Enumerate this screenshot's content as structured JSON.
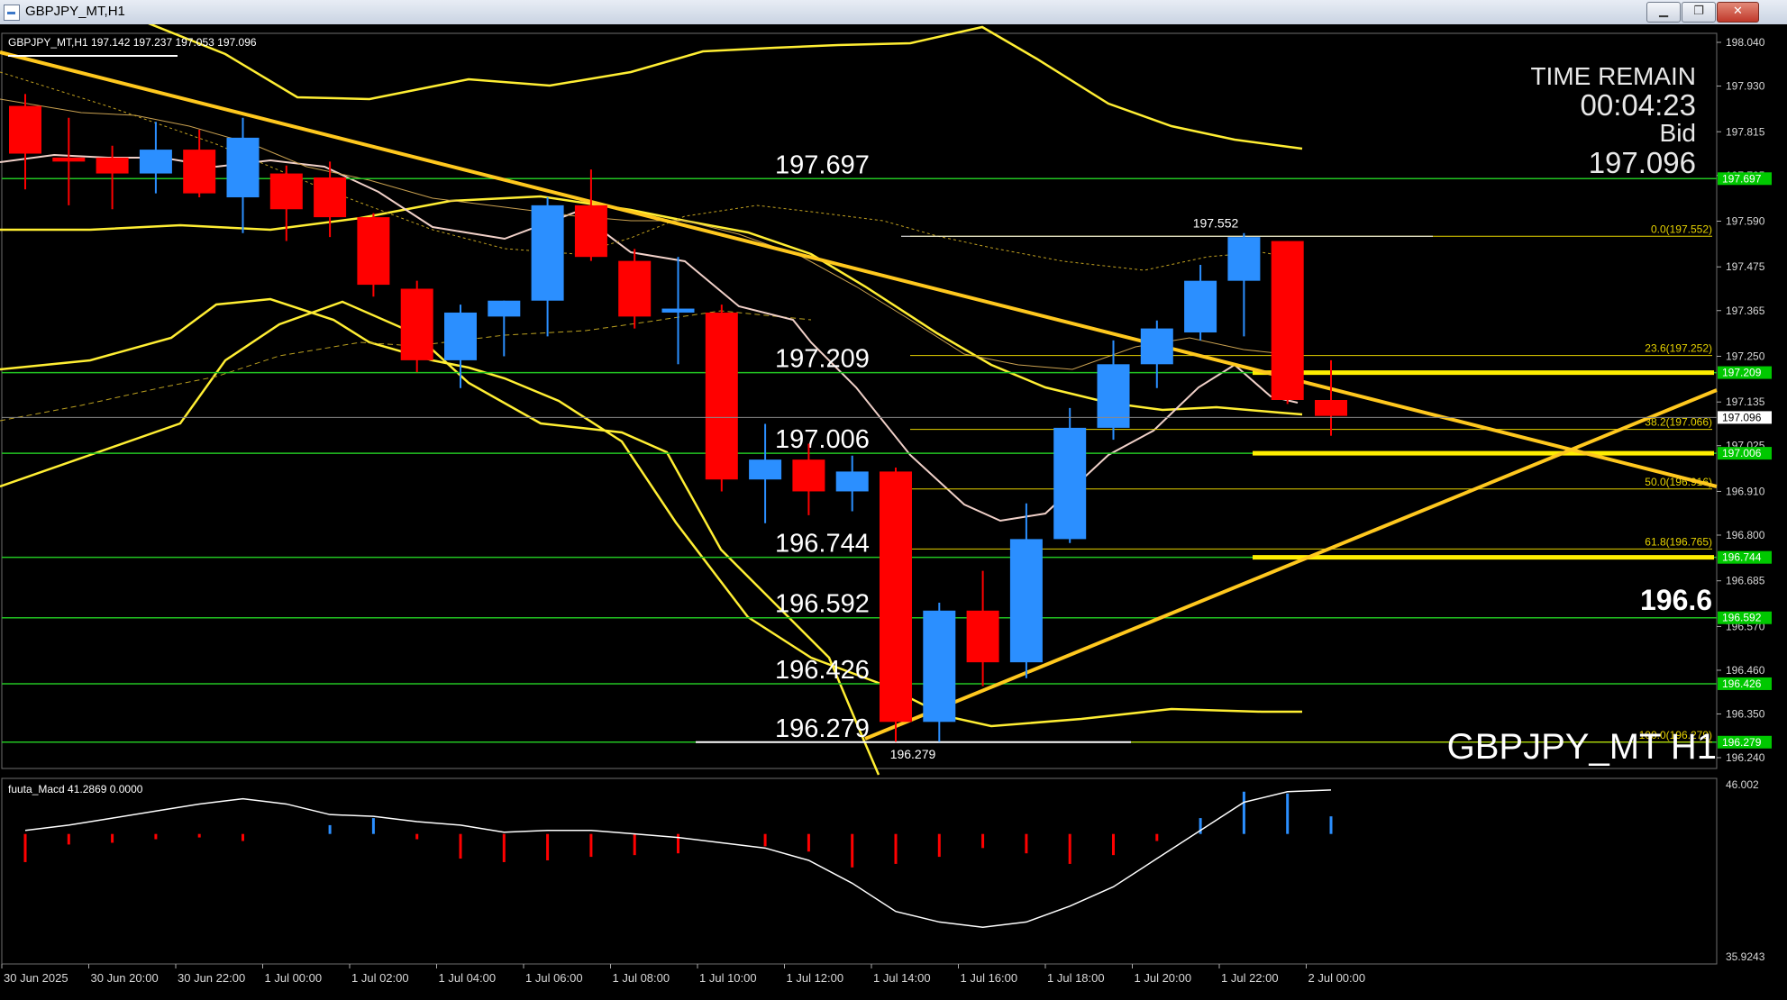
{
  "window": {
    "title": "GBPJPY_MT,H1",
    "controls": {
      "minimize": "▁",
      "maximize": "❐",
      "close": "✕"
    }
  },
  "chart_header": {
    "caption": "GBPJPY_MT,H1  197.142 197.237 197.053 197.096"
  },
  "timer": {
    "time_remain_label": "TIME REMAIN",
    "time_remain_value": "00:04:23",
    "bid_label": "Bid",
    "bid_value": "197.096"
  },
  "big_price_text": "196.6",
  "symbol_label": "GBPJPY_MT H1",
  "macd_caption": "fuuta_Macd 41.2869  0.0000",
  "colors": {
    "background": "#000000",
    "bull_candle": "#2b8fff",
    "bear_candle": "#ff0000",
    "bollinger": "#ffee33",
    "trendline": "#ffc81e",
    "level_line": "#22c422",
    "fibo": "#e6d200",
    "price_label_bg": "#00c800",
    "ma_line": "#f0d0c8"
  },
  "chart_data": {
    "type": "candlestick",
    "symbol": "GBPJPY_MT",
    "timeframe": "H1",
    "ylim": [
      196.24,
      198.04
    ],
    "y_ticks": [
      "198.040",
      "197.930",
      "197.815",
      "197.705",
      "197.590",
      "197.475",
      "197.365",
      "197.250",
      "197.135",
      "197.025",
      "196.910",
      "196.800",
      "196.685",
      "196.570",
      "196.460",
      "196.350",
      "196.240"
    ],
    "x_ticks": [
      "30 Jun 2025",
      "30 Jun 20:00",
      "30 Jun 22:00",
      "1 Jul 00:00",
      "1 Jul 02:00",
      "1 Jul 04:00",
      "1 Jul 06:00",
      "1 Jul 08:00",
      "1 Jul 10:00",
      "1 Jul 12:00",
      "1 Jul 14:00",
      "1 Jul 16:00",
      "1 Jul 18:00",
      "1 Jul 20:00",
      "1 Jul 22:00",
      "2 Jul 00:00"
    ],
    "candles": [
      {
        "o": 197.88,
        "h": 197.91,
        "l": 197.67,
        "c": 197.76
      },
      {
        "o": 197.75,
        "h": 197.85,
        "l": 197.63,
        "c": 197.74
      },
      {
        "o": 197.75,
        "h": 197.78,
        "l": 197.62,
        "c": 197.71
      },
      {
        "o": 197.71,
        "h": 197.84,
        "l": 197.66,
        "c": 197.77
      },
      {
        "o": 197.77,
        "h": 197.82,
        "l": 197.65,
        "c": 197.66
      },
      {
        "o": 197.65,
        "h": 197.85,
        "l": 197.56,
        "c": 197.8
      },
      {
        "o": 197.71,
        "h": 197.73,
        "l": 197.54,
        "c": 197.62
      },
      {
        "o": 197.7,
        "h": 197.74,
        "l": 197.55,
        "c": 197.6
      },
      {
        "o": 197.6,
        "h": 197.61,
        "l": 197.4,
        "c": 197.43
      },
      {
        "o": 197.42,
        "h": 197.44,
        "l": 197.21,
        "c": 197.24
      },
      {
        "o": 197.24,
        "h": 197.38,
        "l": 197.17,
        "c": 197.36
      },
      {
        "o": 197.35,
        "h": 197.39,
        "l": 197.25,
        "c": 197.39
      },
      {
        "o": 197.39,
        "h": 197.65,
        "l": 197.3,
        "c": 197.63
      },
      {
        "o": 197.63,
        "h": 197.72,
        "l": 197.49,
        "c": 197.5
      },
      {
        "o": 197.49,
        "h": 197.52,
        "l": 197.32,
        "c": 197.35
      },
      {
        "o": 197.36,
        "h": 197.5,
        "l": 197.23,
        "c": 197.37
      },
      {
        "o": 197.36,
        "h": 197.38,
        "l": 196.91,
        "c": 196.94
      },
      {
        "o": 196.94,
        "h": 197.08,
        "l": 196.83,
        "c": 196.99
      },
      {
        "o": 196.99,
        "h": 197.03,
        "l": 196.85,
        "c": 196.91
      },
      {
        "o": 196.91,
        "h": 197.0,
        "l": 196.86,
        "c": 196.96
      },
      {
        "o": 196.96,
        "h": 196.97,
        "l": 196.28,
        "c": 196.33
      },
      {
        "o": 196.33,
        "h": 196.63,
        "l": 196.28,
        "c": 196.61
      },
      {
        "o": 196.61,
        "h": 196.71,
        "l": 196.42,
        "c": 196.48
      },
      {
        "o": 196.48,
        "h": 196.88,
        "l": 196.44,
        "c": 196.79
      },
      {
        "o": 196.79,
        "h": 197.12,
        "l": 196.78,
        "c": 197.07
      },
      {
        "o": 197.07,
        "h": 197.29,
        "l": 197.04,
        "c": 197.23
      },
      {
        "o": 197.23,
        "h": 197.34,
        "l": 197.17,
        "c": 197.32
      },
      {
        "o": 197.31,
        "h": 197.48,
        "l": 197.29,
        "c": 197.44
      },
      {
        "o": 197.44,
        "h": 197.56,
        "l": 197.3,
        "c": 197.55
      },
      {
        "o": 197.54,
        "h": 197.54,
        "l": 197.13,
        "c": 197.14
      },
      {
        "o": 197.14,
        "h": 197.24,
        "l": 197.05,
        "c": 197.1
      }
    ],
    "levels": [
      {
        "price": 197.697,
        "label": "197.697",
        "tag": "197.697"
      },
      {
        "price": 197.209,
        "label": "197.209",
        "tag": "197.209"
      },
      {
        "price": 197.006,
        "label": "197.006",
        "tag": "197.006"
      },
      {
        "price": 196.744,
        "label": "196.744",
        "tag": "196.744"
      },
      {
        "price": 196.592,
        "label": "196.592",
        "tag": "196.592"
      },
      {
        "price": 196.426,
        "label": "196.426",
        "tag": "196.426"
      },
      {
        "price": 196.279,
        "label": "196.279",
        "tag": "196.279"
      }
    ],
    "fibo": [
      {
        "price": 197.552,
        "label": "0.0(197.552)"
      },
      {
        "price": 197.252,
        "label": "23.6(197.252)"
      },
      {
        "price": 197.066,
        "label": "38.2(197.066)"
      },
      {
        "price": 196.916,
        "label": "50.0(196.916)"
      },
      {
        "price": 196.765,
        "label": "61.8(196.765)"
      },
      {
        "price": 196.279,
        "label": "100.0(196.279)"
      }
    ],
    "high_label": {
      "price": 197.552,
      "text": "197.552"
    },
    "low_label": {
      "price": 196.279,
      "text": "196.279"
    },
    "current_price": {
      "price": 197.096,
      "text": "197.096"
    },
    "macd": {
      "caption": "fuuta_Macd 41.2869  0.0000",
      "ylim": [
        35.9243,
        46.002
      ],
      "y_ticks": [
        "46.002",
        "35.9243"
      ],
      "histogram": [
        41.4,
        42.4,
        42.5,
        42.7,
        42.8,
        42.6,
        43.0,
        43.5,
        43.9,
        42.7,
        41.6,
        41.4,
        41.5,
        41.7,
        41.8,
        41.9,
        43.0,
        42.3,
        42.0,
        41.1,
        41.3,
        41.7,
        42.2,
        41.9,
        41.3,
        41.8,
        42.6,
        43.9,
        45.4,
        45.3,
        44.0
      ],
      "line": [
        43.2,
        43.5,
        43.9,
        44.3,
        44.7,
        45.0,
        44.7,
        44.1,
        44.0,
        43.7,
        43.5,
        43.1,
        43.2,
        43.2,
        43.0,
        42.8,
        42.5,
        42.2,
        41.5,
        40.2,
        38.6,
        38.0,
        37.7,
        38.0,
        38.9,
        40.0,
        41.6,
        43.2,
        44.8,
        45.4,
        45.5
      ]
    }
  }
}
